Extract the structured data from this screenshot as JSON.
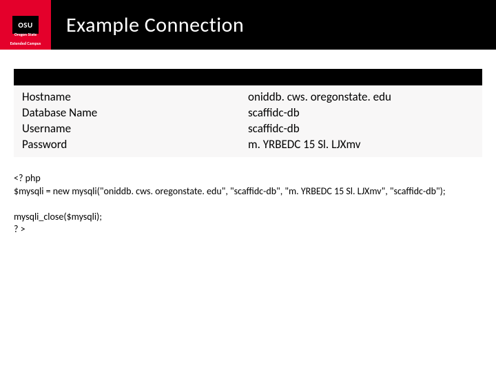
{
  "header": {
    "logo_text": "OSU",
    "logo_subtext1": "Oregon State",
    "logo_subtext2": "Extended Campus",
    "title": "Example Connection"
  },
  "table": {
    "rows": [
      {
        "label": "Hostname",
        "value": "oniddb. cws. oregonstate. edu"
      },
      {
        "label": "Database Name",
        "value": "scaffidc-db"
      },
      {
        "label": "Username",
        "value": "scaffidc-db"
      },
      {
        "label": "Password",
        "value": "m. YRBEDC 15 Sl. LJXmv"
      }
    ]
  },
  "code": {
    "line1": "<? php",
    "line2": "$mysqli = new mysqli(\"oniddb. cws. oregonstate. edu\", \"scaffidc-db\", \"m. YRBEDC 15 Sl. LJXmv\", \"scaffidc-db\");",
    "line3": "mysqli_close($mysqli);",
    "line4": "? >"
  }
}
